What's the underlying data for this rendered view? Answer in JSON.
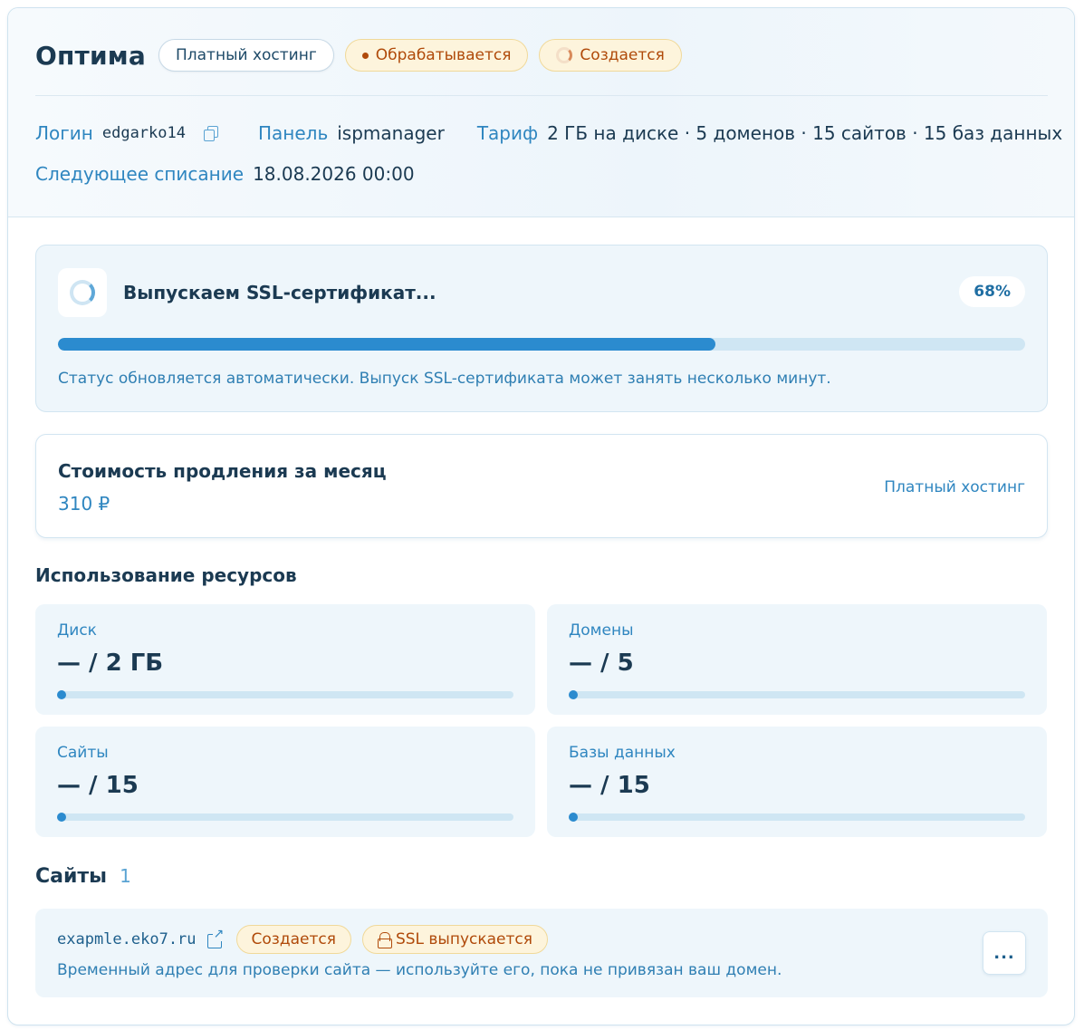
{
  "header": {
    "title": "Оптима",
    "badges": {
      "type": "Платный хостинг",
      "order_status": "Обрабатывается",
      "service_status": "Создается"
    }
  },
  "meta": {
    "login_label": "Логин",
    "login_value": "edgarko14",
    "panel_label": "Панель",
    "panel_value": "ispmanager",
    "tariff_label": "Тариф",
    "tariff_value": "2 ГБ на диске · 5 доменов · 15 сайтов · 15 баз данных",
    "next_charge_label": "Следующее списание",
    "next_charge_value": "18.08.2026 00:00"
  },
  "ssl_progress": {
    "title": "Выпускаем SSL-сертификат...",
    "percent_label": "68%",
    "percent": 68,
    "note": "Статус обновляется автоматически. Выпуск SSL-сертификата может занять несколько минут."
  },
  "renewal": {
    "title": "Стоимость продления за месяц",
    "price": "310 ₽",
    "tag": "Платный хостинг"
  },
  "resources": {
    "title": "Использование ресурсов",
    "items": [
      {
        "label": "Диск",
        "value": "— / 2 ГБ"
      },
      {
        "label": "Домены",
        "value": "— / 5"
      },
      {
        "label": "Сайты",
        "value": "— / 15"
      },
      {
        "label": "Базы данных",
        "value": "— / 15"
      }
    ]
  },
  "sites": {
    "title": "Сайты",
    "count": "1",
    "items": [
      {
        "domain": "exapmle.eko7.ru",
        "status": "Создается",
        "ssl_status": "SSL выпускается",
        "hint": "Временный адрес для проверки сайта — используйте его, пока не привязан ваш домен.",
        "more_label": "..."
      }
    ]
  },
  "colors": {
    "accent": "#2b8bcf",
    "warning_bg": "#fdf4dc",
    "warning_text": "#b04a0a"
  }
}
